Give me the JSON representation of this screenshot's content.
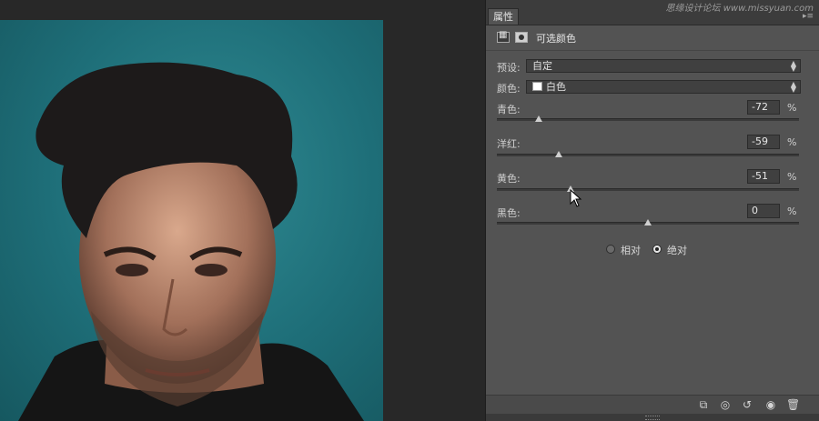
{
  "panel": {
    "tab_label": "属性",
    "menu_glyph": "▸≡",
    "watermark": "思缘设计论坛 www.missyuan.com",
    "adjustment_title": "可选颜色",
    "preset": {
      "label": "预设:",
      "value": "自定"
    },
    "colors": {
      "label": "颜色:",
      "value": "白色",
      "swatch_color": "#ffffff"
    },
    "sliders": [
      {
        "label": "青色:",
        "value": "-72",
        "unit": "%",
        "level": -72
      },
      {
        "label": "洋红:",
        "value": "-59",
        "unit": "%",
        "level": -59
      },
      {
        "label": "黄色:",
        "value": "-51",
        "unit": "%",
        "level": -51
      },
      {
        "label": "黑色:",
        "value": "0",
        "unit": "%",
        "level": 0
      }
    ],
    "method": {
      "relative_label": "相对",
      "absolute_label": "绝对",
      "selected": "absolute"
    },
    "bottom_icons": [
      "clip-to-layer-icon",
      "view-previous-icon",
      "reset-icon",
      "visibility-eye-icon",
      "trash-icon"
    ]
  },
  "colors": {
    "panel_bg": "#535353",
    "canvas_bg": "#282828",
    "photo_bg": "#1f7078"
  }
}
